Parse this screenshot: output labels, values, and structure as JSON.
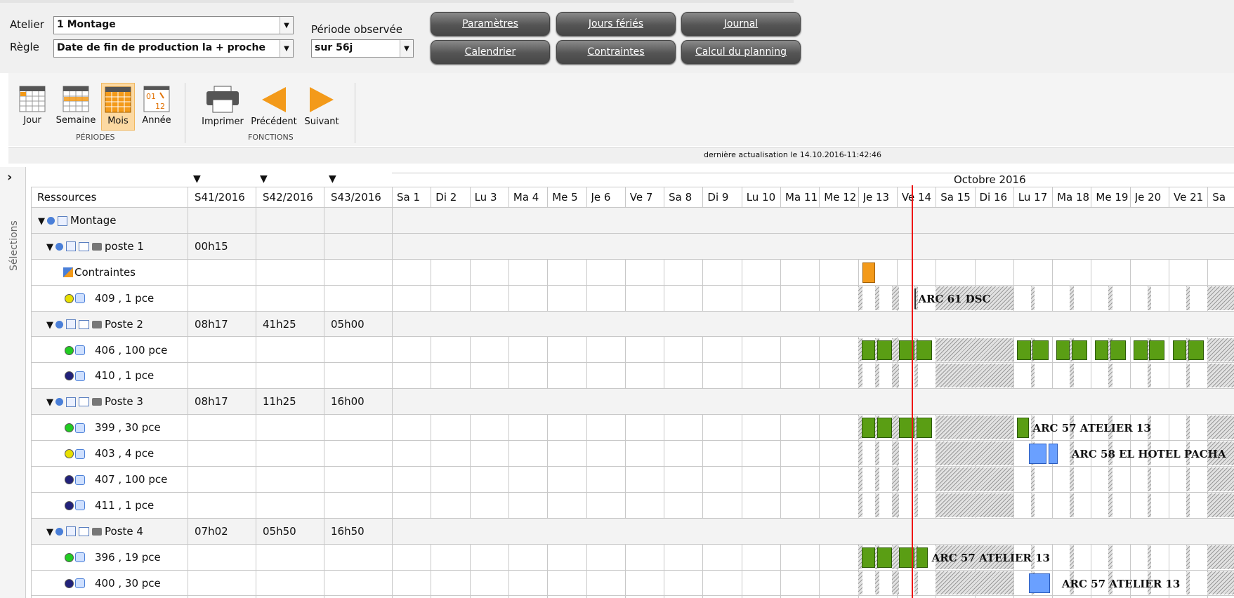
{
  "form": {
    "atelier_label": "Atelier",
    "atelier_value": "1 Montage",
    "regle_label": "Règle",
    "regle_value": "Date de fin de production la + proche",
    "periode_label": "Période observée",
    "periode_value": "sur 56j"
  },
  "buttons": {
    "parametres": "Paramètres",
    "jours_feries": "Jours fériés",
    "journal": "Journal",
    "calendrier": "Calendrier",
    "contraintes": "Contraintes",
    "calcul": "Calcul du planning"
  },
  "ribbon": {
    "jour": "Jour",
    "semaine": "Semaine",
    "mois": "Mois",
    "annee": "Année",
    "annee_icon_top": "01",
    "annee_icon_bottom": "12",
    "periodes_group": "PÉRIODES",
    "imprimer": "Imprimer",
    "precedent": "Précédent",
    "suivant": "Suivant",
    "fonctions_group": "FONCTIONS",
    "active_period": "Mois"
  },
  "status": {
    "last_update": "dernière actualisation le 14.10.2016-11:42:46"
  },
  "side": {
    "label": "Sélections"
  },
  "grid": {
    "month": "Octobre 2016",
    "resources_header": "Ressources",
    "weeks": [
      "S41/2016",
      "S42/2016",
      "S43/2016"
    ],
    "days": [
      "Sa 1",
      "Di 2",
      "Lu 3",
      "Ma 4",
      "Me 5",
      "Je 6",
      "Ve 7",
      "Sa 8",
      "Di 9",
      "Lu 10",
      "Ma 11",
      "Me 12",
      "Je 13",
      "Ve 14",
      "Sa 15",
      "Di 16",
      "Lu 17",
      "Ma 18",
      "Me 19",
      "Je 20",
      "Ve 21",
      "Sa"
    ]
  },
  "rows": [
    {
      "label": "Montage",
      "type": "group0",
      "w": [
        "",
        "",
        ""
      ]
    },
    {
      "label": "poste 1",
      "type": "group1",
      "w": [
        "00h15",
        "",
        ""
      ]
    },
    {
      "label": "Contraintes",
      "type": "constraint",
      "w": [
        "",
        "",
        ""
      ]
    },
    {
      "label": "409 , 1 pce",
      "type": "item",
      "dot": "#e8e000",
      "w": [
        "",
        "",
        ""
      ]
    },
    {
      "label": "Poste 2",
      "type": "group1",
      "w": [
        "08h17",
        "41h25",
        "05h00"
      ]
    },
    {
      "label": "406 , 100 pce",
      "type": "item",
      "dot": "#22cc22",
      "w": [
        "",
        "",
        ""
      ]
    },
    {
      "label": "410 , 1 pce",
      "type": "item",
      "dot": "#22227a",
      "w": [
        "",
        "",
        ""
      ]
    },
    {
      "label": "Poste 3",
      "type": "group1",
      "w": [
        "08h17",
        "11h25",
        "16h00"
      ]
    },
    {
      "label": "399 , 30 pce",
      "type": "item",
      "dot": "#22cc22",
      "w": [
        "",
        "",
        ""
      ]
    },
    {
      "label": "403 , 4 pce",
      "type": "item",
      "dot": "#e8e000",
      "w": [
        "",
        "",
        ""
      ]
    },
    {
      "label": "407 , 100 pce",
      "type": "item",
      "dot": "#22227a",
      "w": [
        "",
        "",
        ""
      ]
    },
    {
      "label": "411 , 1 pce",
      "type": "item",
      "dot": "#22227a",
      "w": [
        "",
        "",
        ""
      ]
    },
    {
      "label": "Poste 4",
      "type": "group1",
      "w": [
        "07h02",
        "05h50",
        "16h50"
      ]
    },
    {
      "label": "396 , 19 pce",
      "type": "item",
      "dot": "#22cc22",
      "w": [
        "",
        "",
        ""
      ]
    },
    {
      "label": "400 , 30 pce",
      "type": "item",
      "dot": "#22227a",
      "w": [
        "",
        "",
        ""
      ]
    }
  ],
  "bar_labels": {
    "r3": "ARC 61 DSC",
    "r8": "ARC 57 ATELIER 13",
    "r9": "ARC 58 EL HOTEL PACHA",
    "r13": "ARC 57 ATELIER 13",
    "r14": "ARC 57 ATELIER 13"
  },
  "colors": {
    "green": "#5a9e14",
    "blue": "#6aa0ff",
    "orange": "#f39a1a",
    "today_line": "#e11111"
  }
}
